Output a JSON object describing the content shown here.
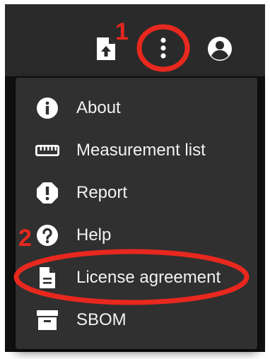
{
  "toolbar": {
    "icons": [
      "file-upload-icon",
      "more-vert-icon",
      "account-circle-icon"
    ]
  },
  "menu": {
    "items": [
      {
        "label": "About",
        "icon": "info-icon"
      },
      {
        "label": "Measurement list",
        "icon": "ruler-icon"
      },
      {
        "label": "Report",
        "icon": "report-icon"
      },
      {
        "label": "Help",
        "icon": "help-icon"
      },
      {
        "label": "License agreement",
        "icon": "document-icon"
      },
      {
        "label": "SBOM",
        "icon": "archive-icon"
      }
    ]
  },
  "annotations": {
    "step1": "1",
    "step2": "2",
    "color": "#e8281e"
  },
  "colors": {
    "topbar": "#2a2a2a",
    "menu": "#303030",
    "text": "#f2f2f2"
  }
}
